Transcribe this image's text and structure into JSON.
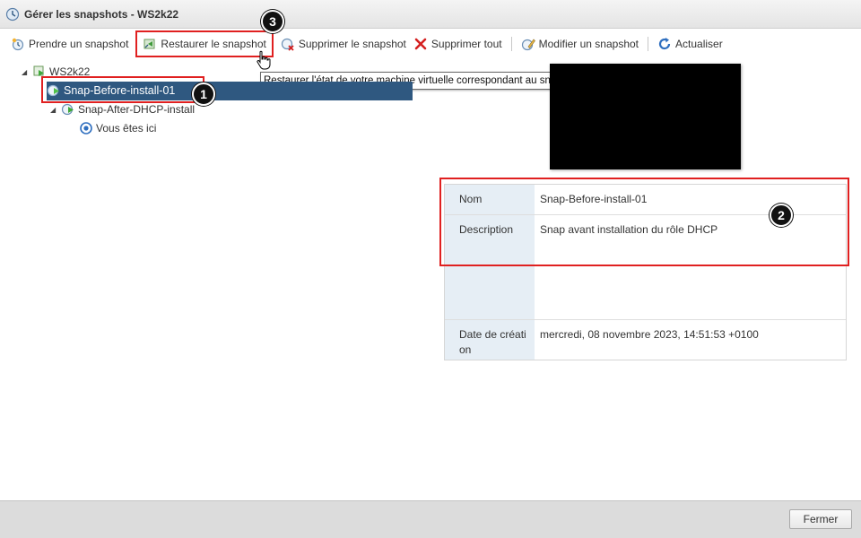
{
  "window": {
    "title": "Gérer les snapshots - WS2k22"
  },
  "toolbar": {
    "take": "Prendre un snapshot",
    "restore": "Restaurer le snapshot",
    "delete": "Supprimer le snapshot",
    "delete_all": "Supprimer tout",
    "edit": "Modifier un snapshot",
    "refresh": "Actualiser"
  },
  "tooltip": "Restaurer l'état de votre machine virtuelle correspondant au snapshot sélectionné.",
  "tree": {
    "root": "WS2k22",
    "snap1": "Snap-Before-install-01",
    "snap2": "Snap-After-DHCP-install",
    "here": "Vous êtes ici"
  },
  "props": {
    "name_label": "Nom",
    "name_value": "Snap-Before-install-01",
    "desc_label": "Description",
    "desc_value": "Snap avant installation du rôle DHCP",
    "date_label": "Date de création",
    "date_value": "mercredi, 08 novembre 2023, 14:51:53 +0100"
  },
  "callouts": {
    "one": "1",
    "two": "2",
    "three": "3"
  },
  "footer": {
    "close": "Fermer"
  },
  "colors": {
    "selection": "#2f5880",
    "highlight": "#e02020",
    "label_bg": "#e6eef5"
  }
}
